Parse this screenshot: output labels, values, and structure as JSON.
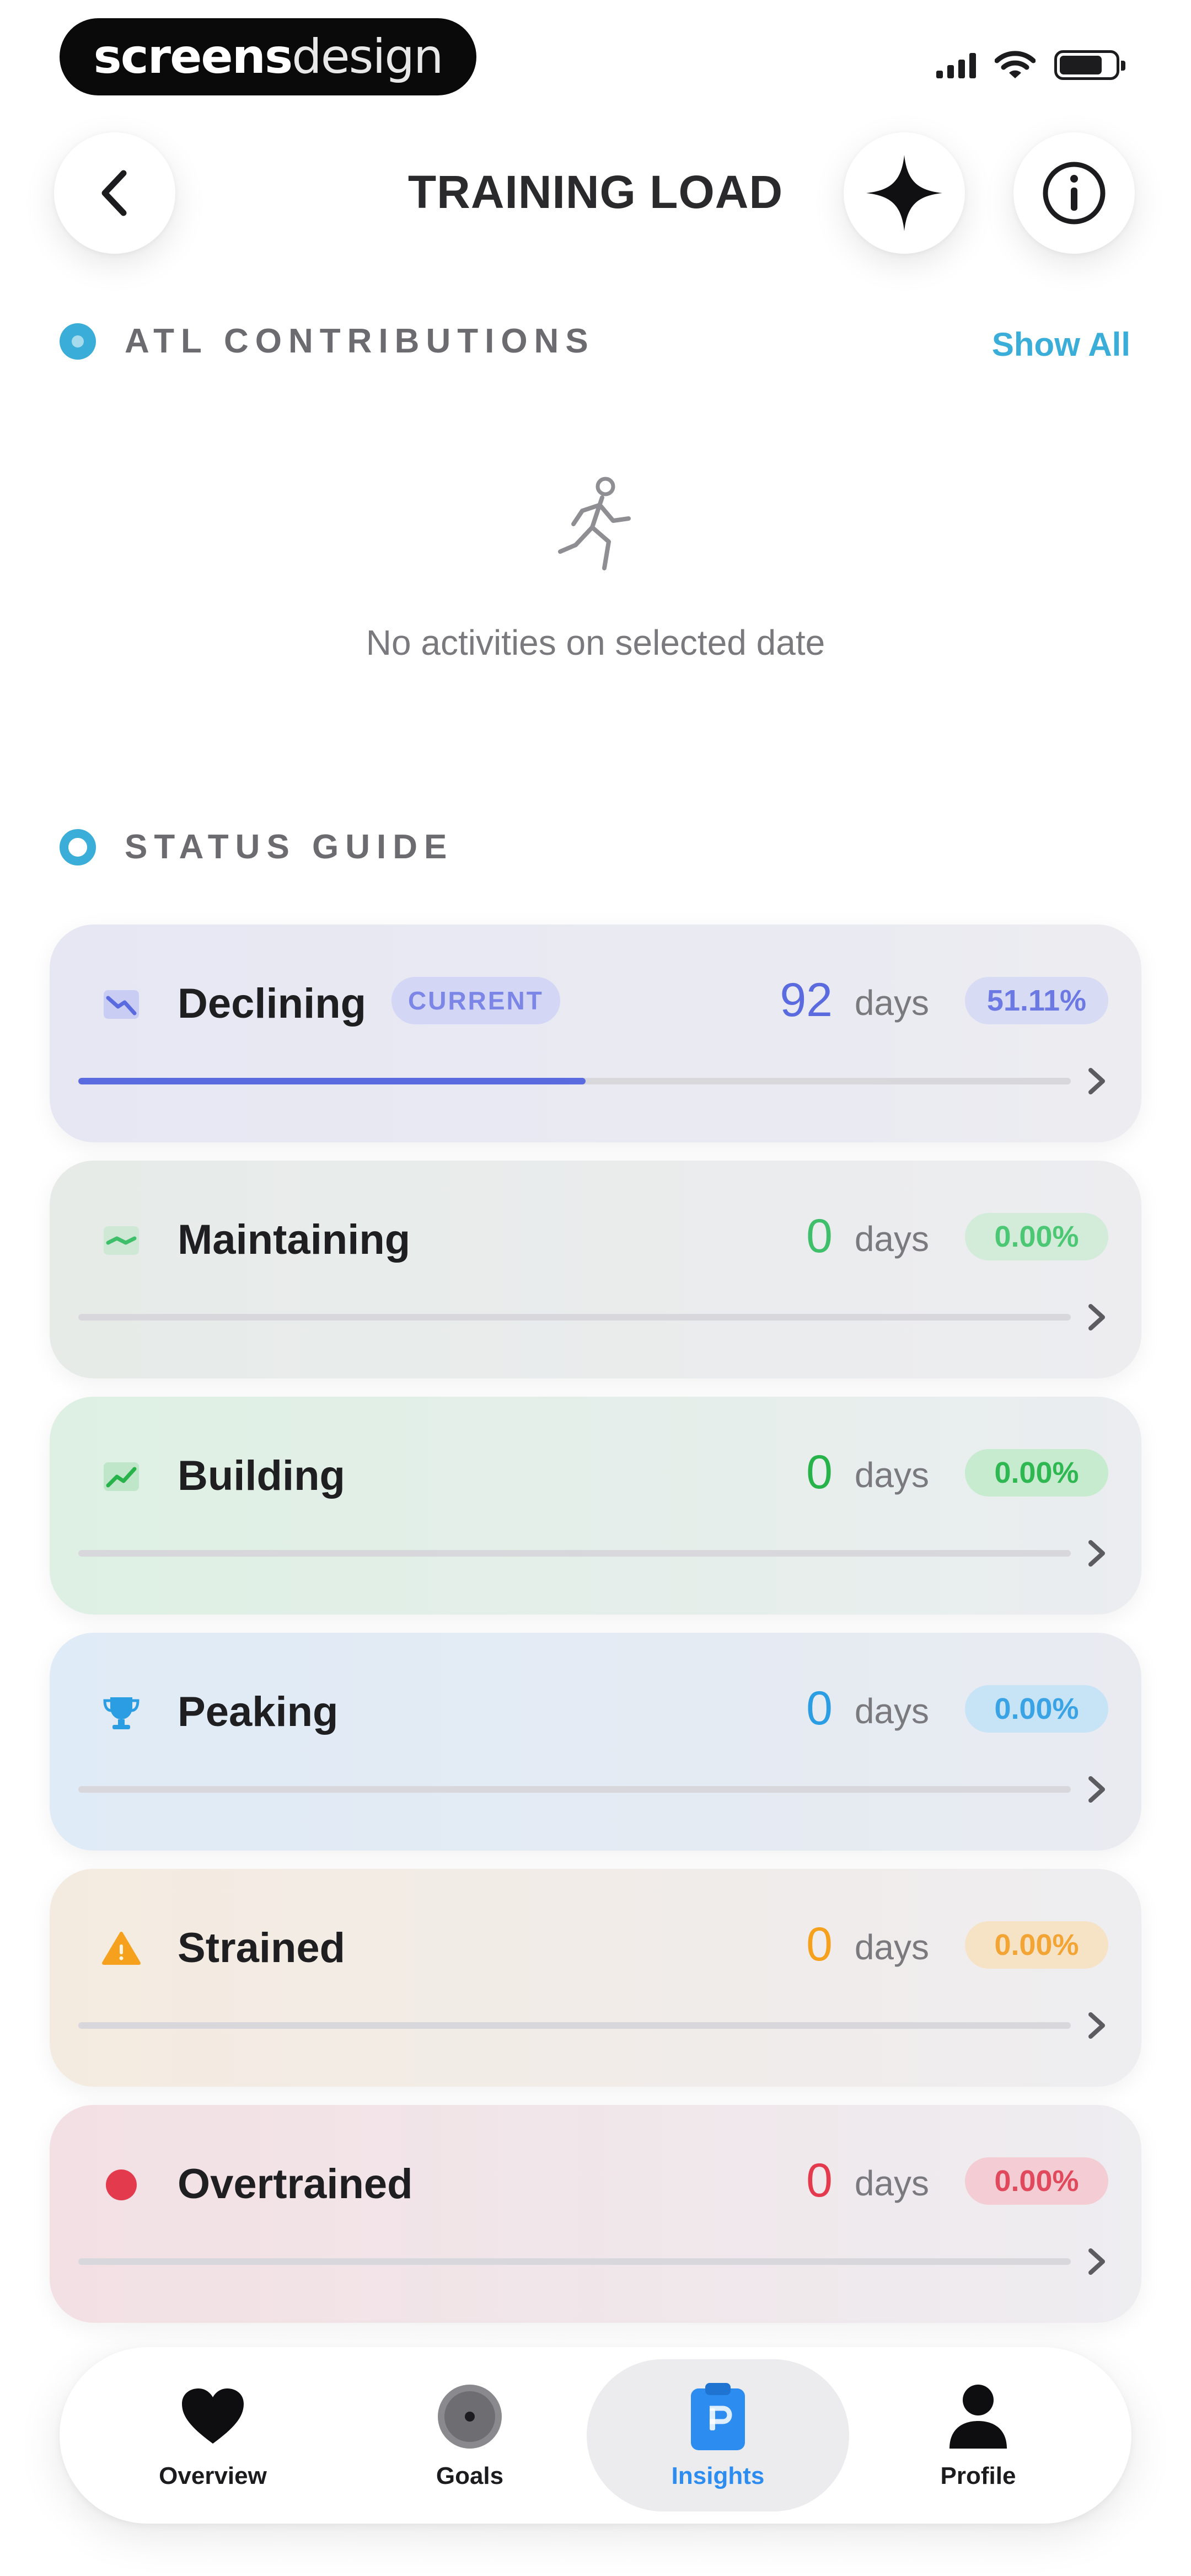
{
  "status_bar": {
    "watermark_part1": "screens",
    "watermark_part2": "design"
  },
  "header": {
    "title": "TRAINING LOAD"
  },
  "atl_section": {
    "title": "ATL CONTRIBUTIONS",
    "show_all_label": "Show All",
    "empty_text": "No activities on selected date"
  },
  "status_guide": {
    "title": "STATUS GUIDE",
    "items": [
      {
        "label": "Declining",
        "badge": "CURRENT",
        "days": "92",
        "days_unit": "days",
        "percent": "51.11%",
        "progress": 0.5111,
        "color": "#5a6be0",
        "icon": "trending-down-icon"
      },
      {
        "label": "Maintaining",
        "days": "0",
        "days_unit": "days",
        "percent": "0.00%",
        "progress": 0,
        "color": "#3fbf6a",
        "icon": "steady-chart-icon"
      },
      {
        "label": "Building",
        "days": "0",
        "days_unit": "days",
        "percent": "0.00%",
        "progress": 0,
        "color": "#27b34a",
        "icon": "trending-up-icon"
      },
      {
        "label": "Peaking",
        "days": "0",
        "days_unit": "days",
        "percent": "0.00%",
        "progress": 0,
        "color": "#2b9de3",
        "icon": "trophy-icon"
      },
      {
        "label": "Strained",
        "days": "0",
        "days_unit": "days",
        "percent": "0.00%",
        "progress": 0,
        "color": "#f5a11e",
        "icon": "warning-icon"
      },
      {
        "label": "Overtrained",
        "days": "0",
        "days_unit": "days",
        "percent": "0.00%",
        "progress": 0,
        "color": "#e43a4e",
        "icon": "red-dot-icon"
      }
    ]
  },
  "tabs": [
    {
      "label": "Overview",
      "icon": "heart-icon",
      "active": false
    },
    {
      "label": "Goals",
      "icon": "target-icon",
      "active": false
    },
    {
      "label": "Insights",
      "icon": "clipboard-icon",
      "active": true
    },
    {
      "label": "Profile",
      "icon": "person-icon",
      "active": false
    }
  ]
}
